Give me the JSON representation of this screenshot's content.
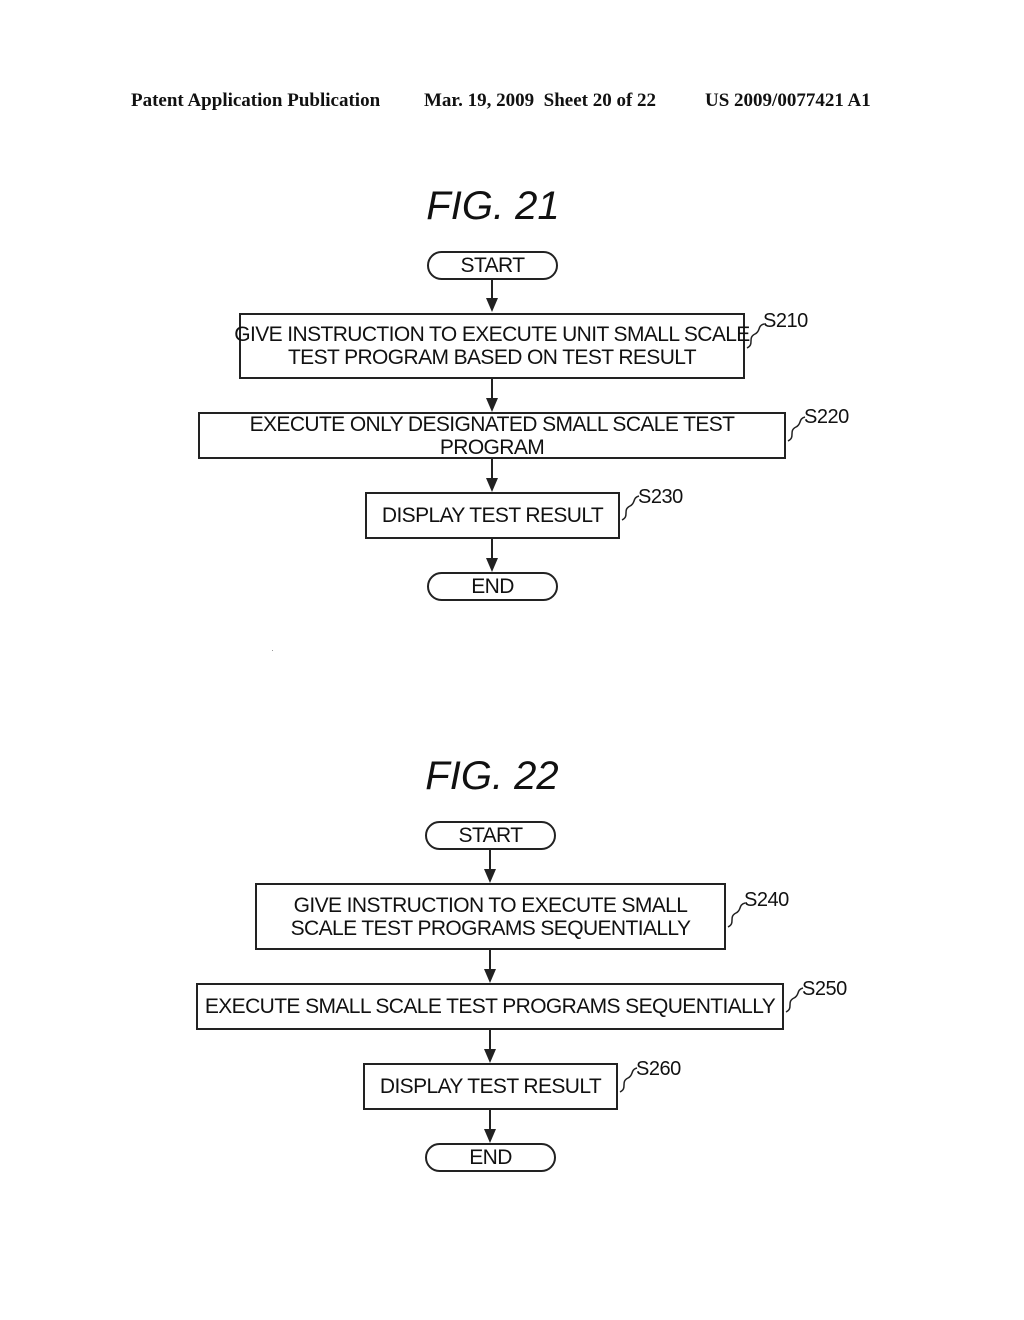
{
  "header": {
    "publication": "Patent Application Publication",
    "date_sheet": "Mar. 19, 2009  Sheet 20 of 22",
    "number": "US 2009/0077421 A1"
  },
  "figures": [
    {
      "title": "FIG. 21",
      "start": "START",
      "end": "END",
      "steps": [
        {
          "id": "S210",
          "text": "GIVE INSTRUCTION TO EXECUTE UNIT SMALL SCALE\nTEST PROGRAM BASED ON TEST RESULT"
        },
        {
          "id": "S220",
          "text": "EXECUTE ONLY DESIGNATED SMALL SCALE TEST PROGRAM"
        },
        {
          "id": "S230",
          "text": "DISPLAY TEST RESULT"
        }
      ]
    },
    {
      "title": "FIG. 22",
      "start": "START",
      "end": "END",
      "steps": [
        {
          "id": "S240",
          "text": "GIVE INSTRUCTION TO EXECUTE SMALL\nSCALE TEST PROGRAMS SEQUENTIALLY"
        },
        {
          "id": "S250",
          "text": "EXECUTE SMALL SCALE TEST PROGRAMS SEQUENTIALLY"
        },
        {
          "id": "S260",
          "text": "DISPLAY TEST RESULT"
        }
      ]
    }
  ]
}
